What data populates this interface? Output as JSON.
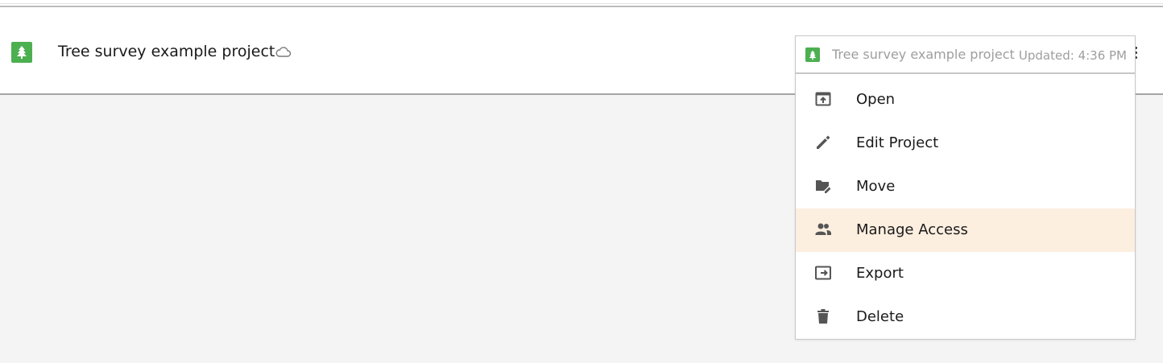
{
  "project": {
    "title": "Tree survey example project",
    "app_icon": "tree-icon",
    "sync_icon": "cloud-icon",
    "menu_icon": "kebab-menu-icon"
  },
  "menu": {
    "header_title": "Tree survey example project",
    "updated": "Updated: 4:36 PM",
    "items": [
      {
        "label": "Open",
        "icon": "open-icon"
      },
      {
        "label": "Edit Project",
        "icon": "pencil-icon"
      },
      {
        "label": "Move",
        "icon": "folder-move-icon"
      },
      {
        "label": "Manage Access",
        "icon": "people-icon",
        "highlighted": true
      },
      {
        "label": "Export",
        "icon": "export-icon"
      },
      {
        "label": "Delete",
        "icon": "trash-icon"
      }
    ]
  },
  "colors": {
    "brand_green": "#4caf50",
    "highlight": "#fdefe0",
    "icon_gray": "#555555",
    "muted_text": "#9e9e9e"
  }
}
